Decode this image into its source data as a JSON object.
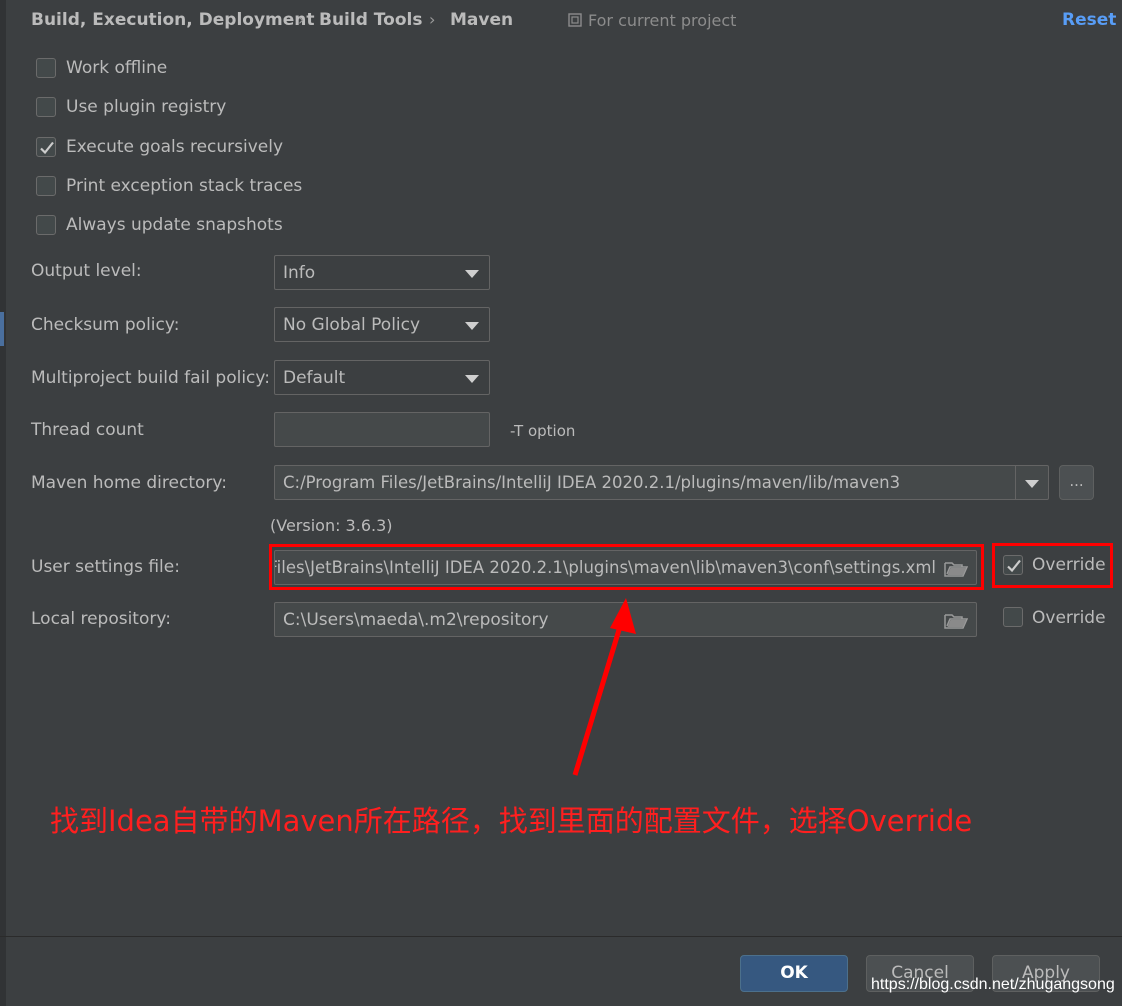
{
  "header": {
    "breadcrumb": [
      "Build, Execution, Deployment",
      "Build Tools",
      "Maven"
    ],
    "separator": "›",
    "scope_label": "For current project",
    "reset_label": "Reset"
  },
  "checkboxes": [
    {
      "label": "Work offline",
      "checked": false
    },
    {
      "label": "Use plugin registry",
      "checked": false
    },
    {
      "label": "Execute goals recursively",
      "checked": true
    },
    {
      "label": "Print exception stack traces",
      "checked": false
    },
    {
      "label": "Always update snapshots",
      "checked": false
    }
  ],
  "output_level": {
    "label": "Output level:",
    "value": "Info"
  },
  "checksum_policy": {
    "label": "Checksum policy:",
    "value": "No Global Policy"
  },
  "fail_policy": {
    "label": "Multiproject build fail policy:",
    "value": "Default"
  },
  "thread_count": {
    "label": "Thread count",
    "value": "",
    "note": "-T option"
  },
  "maven_home": {
    "label": "Maven home directory:",
    "value": "C:/Program Files/JetBrains/IntelliJ IDEA 2020.2.1/plugins/maven/lib/maven3",
    "browse_label": "...",
    "version": "(Version: 3.6.3)"
  },
  "user_settings": {
    "label": "User settings file:",
    "value": "C:\\Program Files\\JetBrains\\IntelliJ IDEA 2020.2.1\\plugins\\maven\\lib\\maven3\\conf\\settings.xml",
    "override_label": "Override",
    "override_checked": true
  },
  "local_repo": {
    "label": "Local repository:",
    "value": "C:\\Users\\maeda\\.m2\\repository",
    "override_label": "Override",
    "override_checked": false
  },
  "annotation": {
    "text": "找到Idea自带的Maven所在路径，找到里面的配置文件，选择Override",
    "color": "#ff0000"
  },
  "buttons": {
    "ok": "OK",
    "cancel": "Cancel",
    "apply": "Apply"
  },
  "watermark": "https://blog.csdn.net/zhugangsong",
  "colors": {
    "background": "#3c3f41",
    "link": "#589df6",
    "primary": "#365880"
  }
}
